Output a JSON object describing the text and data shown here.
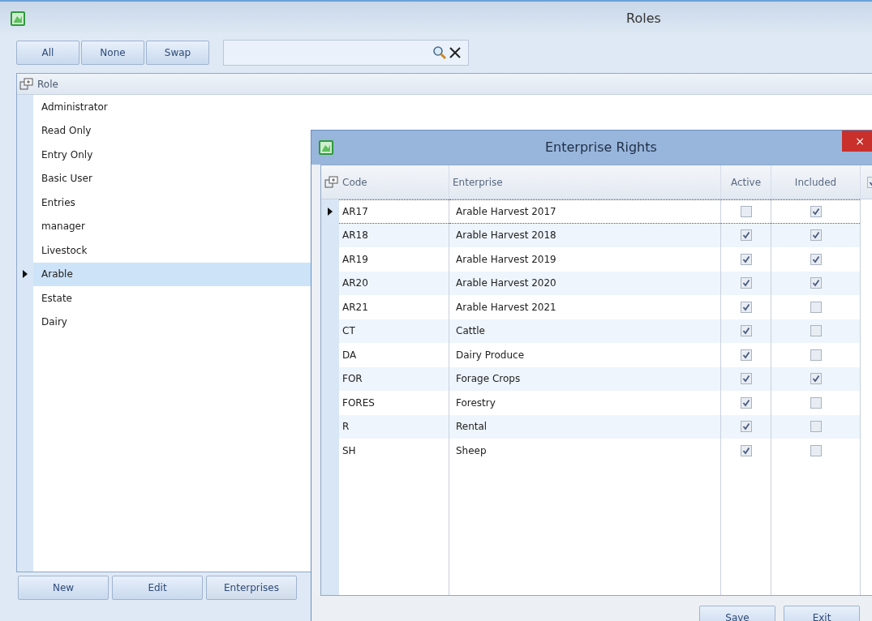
{
  "window": {
    "title": "Roles"
  },
  "toolbar": {
    "buttons": [
      "All",
      "None",
      "Swap"
    ]
  },
  "roles_grid": {
    "column": "Role",
    "rows": [
      {
        "name": "Administrator",
        "selected": false
      },
      {
        "name": "Read Only",
        "selected": false
      },
      {
        "name": "Entry Only",
        "selected": false
      },
      {
        "name": "Basic User",
        "selected": false
      },
      {
        "name": "Entries",
        "selected": false
      },
      {
        "name": "manager",
        "selected": false
      },
      {
        "name": "Livestock",
        "selected": false
      },
      {
        "name": "Arable",
        "selected": true
      },
      {
        "name": "Estate",
        "selected": false
      },
      {
        "name": "Dairy",
        "selected": false
      }
    ]
  },
  "bottom_buttons": [
    "New",
    "Edit",
    "Enterprises"
  ],
  "dialog": {
    "title": "Enterprise Rights",
    "close": "×",
    "columns": [
      "Code",
      "Enterprise",
      "Active",
      "Included"
    ],
    "select_all_checked": true,
    "rows": [
      {
        "code": "AR17",
        "enterprise": "Arable Harvest 2017",
        "active": false,
        "included": true,
        "selected": true
      },
      {
        "code": "AR18",
        "enterprise": "Arable Harvest 2018",
        "active": true,
        "included": true,
        "selected": false
      },
      {
        "code": "AR19",
        "enterprise": "Arable Harvest 2019",
        "active": true,
        "included": true,
        "selected": false
      },
      {
        "code": "AR20",
        "enterprise": "Arable Harvest 2020",
        "active": true,
        "included": true,
        "selected": false
      },
      {
        "code": "AR21",
        "enterprise": "Arable Harvest 2021",
        "active": true,
        "included": false,
        "selected": false
      },
      {
        "code": "CT",
        "enterprise": "Cattle",
        "active": true,
        "included": false,
        "selected": false
      },
      {
        "code": "DA",
        "enterprise": "Dairy Produce",
        "active": true,
        "included": false,
        "selected": false
      },
      {
        "code": "FOR",
        "enterprise": "Forage Crops",
        "active": true,
        "included": true,
        "selected": false
      },
      {
        "code": "FORES",
        "enterprise": "Forestry",
        "active": true,
        "included": false,
        "selected": false
      },
      {
        "code": "R",
        "enterprise": "Rental",
        "active": true,
        "included": false,
        "selected": false
      },
      {
        "code": "SH",
        "enterprise": "Sheep",
        "active": true,
        "included": false,
        "selected": false
      }
    ],
    "buttons": [
      "Save",
      "Exit"
    ]
  }
}
